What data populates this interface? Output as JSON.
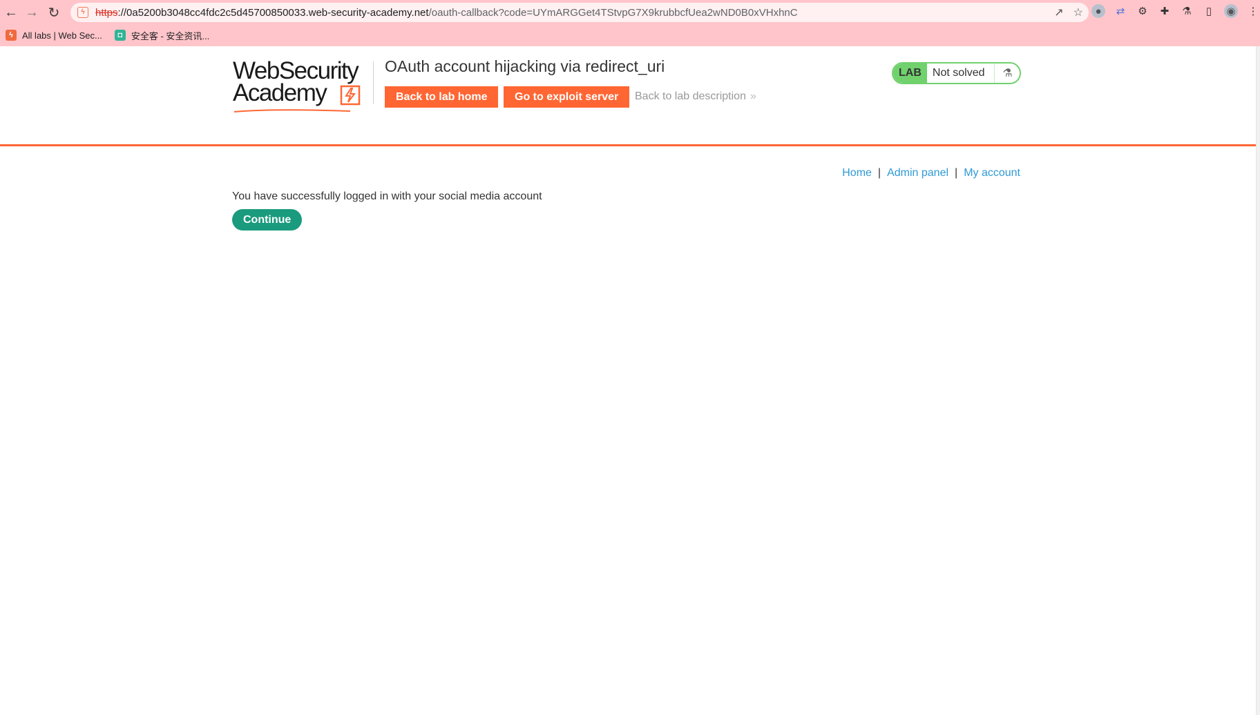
{
  "browser": {
    "url_scheme": "https",
    "url_host": "://0a5200b3048cc4fdc2c5d45700850033.web-security-academy.net",
    "url_path": "/oauth-callback?code=UYmARGGet4TStvpG7X9krubbcfUea2wND0B0xVHxhnC",
    "bookmarks": [
      {
        "label": "All labs | Web Sec...",
        "icon": "portswigger-icon"
      },
      {
        "label": "安全客 - 安全资讯...",
        "icon": "anquanke-icon"
      }
    ]
  },
  "header": {
    "logo_line1": "WebSecurity",
    "logo_line2": "Academy",
    "lab_title": "OAuth account hijacking via redirect_uri",
    "back_to_lab_home": "Back to lab home",
    "go_to_exploit_server": "Go to exploit server",
    "back_to_description": "Back to lab description",
    "status_badge": "LAB",
    "status_text": "Not solved"
  },
  "nav": {
    "home": "Home",
    "admin_panel": "Admin panel",
    "my_account": "My account",
    "separator": "|"
  },
  "main": {
    "message": "You have successfully logged in with your social media account",
    "continue_label": "Continue"
  },
  "colors": {
    "accent": "#ff6633",
    "continue": "#1a9b7d",
    "lab_badge": "#70d16d",
    "link": "#2e9ad4",
    "chrome_bg": "#ffc5ca"
  }
}
